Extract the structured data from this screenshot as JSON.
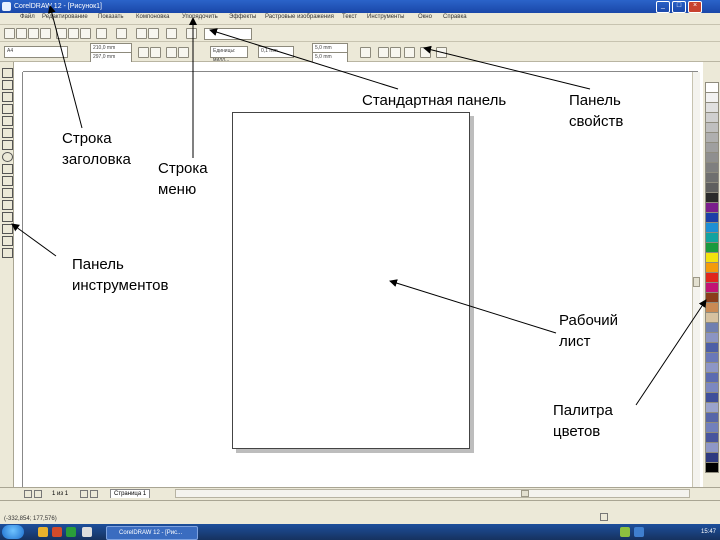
{
  "titlebar": {
    "title": "CorelDRAW 12 - [Рисунок1]",
    "icon": "coreldraw-app-icon",
    "controls": [
      "_",
      "□",
      "×"
    ]
  },
  "menu": {
    "items": [
      "Файл",
      "Редактирование",
      "Показать",
      "Компоновка",
      "Упорядочить",
      "Эффекты",
      "Растровые изображения",
      "Текст",
      "Инструменты",
      "Окно",
      "Справка"
    ]
  },
  "properties": {
    "paper_size": "A4",
    "width": "210,0 mm",
    "height": "297,0 mm",
    "units": "Единицы: милл...",
    "nudge": "0,1 mm",
    "duplicate_x": "5,0 mm",
    "duplicate_y": "5,0 mm",
    "zoom": "Ш"
  },
  "pagenav": {
    "page_counter": "1 из 1",
    "page_tab": "Страница 1"
  },
  "statusbar": {
    "text": "(-332,854; 177,576)"
  },
  "taskbar": {
    "app_label": "CorelDRAW 12 - [Рис...",
    "clock": "15:47"
  },
  "annotations": {
    "title_row": [
      "Строка",
      "заголовка"
    ],
    "menu_row": [
      "Строка",
      "меню"
    ],
    "standard_panel": "Стандартная панель",
    "properties_panel": [
      "Панель",
      "свойств"
    ],
    "toolbox": [
      "Панель",
      "инструментов"
    ],
    "worksheet": [
      "Рабочий",
      "лист"
    ],
    "palette": [
      "Палитра",
      "цветов"
    ]
  },
  "palette_colors": [
    "#ffffff",
    "#f2f2f2",
    "#e0e0e0",
    "#cfcfcf",
    "#bfbfbf",
    "#afafaf",
    "#9f9f9f",
    "#8f8f8f",
    "#7f7f7f",
    "#6f6f6f",
    "#5f5f5f",
    "#2a2a2a",
    "#7a1e8c",
    "#1d3fa8",
    "#1e8fd4",
    "#13a3a0",
    "#1a9a3e",
    "#f2e20f",
    "#f39b0b",
    "#e0261c",
    "#c21475",
    "#8a3e1a",
    "#c98a54",
    "#d6c2a0",
    "#6f7fb0",
    "#8b94c2",
    "#4d5fa6",
    "#6a78b8",
    "#8d96c6",
    "#5c6bb0",
    "#7c88c0",
    "#3f4f9a",
    "#9aa3cc",
    "#5766a8",
    "#7280bb",
    "#48559d",
    "#8e97c7",
    "#2e3a80",
    "#000000"
  ]
}
